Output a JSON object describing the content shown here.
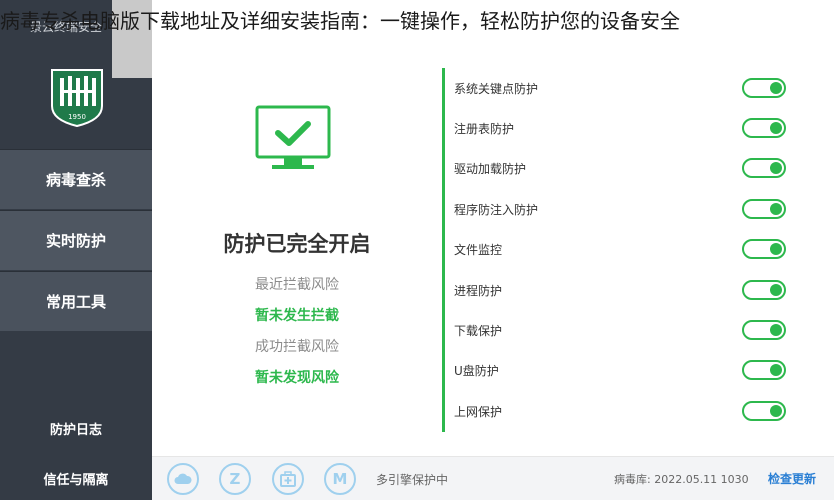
{
  "overlay": {
    "caption": "病毒专杀电脑版下载地址及详细安装指南：一键操作，轻松防护您的设备安全"
  },
  "app": {
    "title": "景云终端安全"
  },
  "logo": {
    "year": "1950"
  },
  "sidebar": {
    "items": [
      {
        "label": "病毒查杀"
      },
      {
        "label": "实时防护"
      },
      {
        "label": "常用工具"
      }
    ],
    "active_index": 1,
    "bottom": [
      {
        "label": "防护日志"
      },
      {
        "label": "信任与隔离"
      }
    ]
  },
  "status": {
    "heading": "防护已完全开启",
    "recent_label": "最近拦截风险",
    "recent_value": "暂未发生拦截",
    "success_label": "成功拦截风险",
    "success_value": "暂未发现风险"
  },
  "protections": [
    {
      "label": "系统关键点防护",
      "enabled": true
    },
    {
      "label": "注册表防护",
      "enabled": true
    },
    {
      "label": "驱动加载防护",
      "enabled": true
    },
    {
      "label": "程序防注入防护",
      "enabled": true
    },
    {
      "label": "文件监控",
      "enabled": true
    },
    {
      "label": "进程防护",
      "enabled": true
    },
    {
      "label": "下载保护",
      "enabled": true
    },
    {
      "label": "U盘防护",
      "enabled": true
    },
    {
      "label": "上网保护",
      "enabled": true
    }
  ],
  "footer": {
    "icons": [
      "cloud-icon",
      "z-engine-icon",
      "medkit-icon",
      "m-engine-icon"
    ],
    "engine_text": "多引擎保护中",
    "virus_db": "病毒库: 2022.05.11 1030",
    "check_update": "检查更新"
  },
  "colors": {
    "sidebar_bg": "#343b45",
    "accent_green": "#2db84d",
    "link_blue": "#2a7fd4"
  }
}
